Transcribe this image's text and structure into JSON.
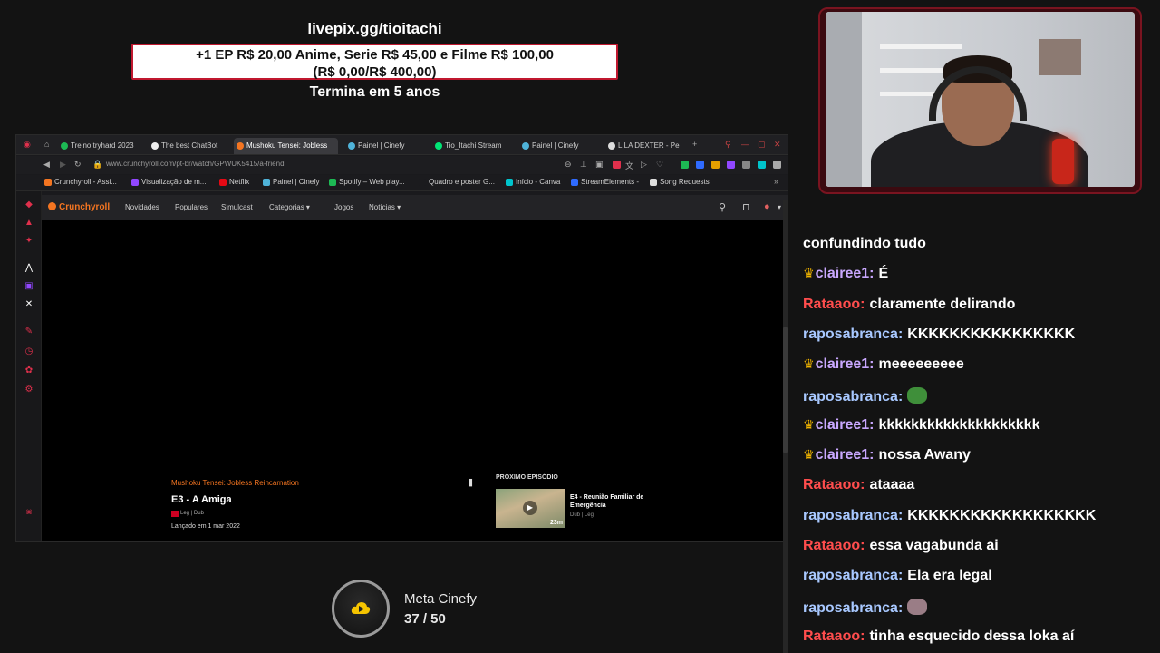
{
  "overlay": {
    "livepix_url": "livepix.gg/tioitachi",
    "goal_line1": "+1 EP R$ 20,00 Anime, Serie R$ 45,00 e Filme R$ 100,00",
    "goal_line2": "(R$ 0,00/R$ 400,00)",
    "termina": "Termina em 5 anos",
    "meta_title": "Meta Cinefy",
    "meta_count": "37 / 50",
    "accent": "#c0182f"
  },
  "browser": {
    "tabs": [
      {
        "label": "Treino tryhard 2023",
        "color": "#1db954",
        "active": false
      },
      {
        "label": "The best ChatBot",
        "color": "#eeeeee",
        "active": false
      },
      {
        "label": "Mushoku Tensei: Jobless",
        "color": "#f47521",
        "active": true
      },
      {
        "label": "Painel | Cinefy",
        "color": "#4fb3d9",
        "active": false
      },
      {
        "label": "Tio_Itachi Stream",
        "color": "#00e676",
        "active": false
      },
      {
        "label": "Painel | Cinefy",
        "color": "#4fb3d9",
        "active": false
      },
      {
        "label": "LILA DEXTER - Pe",
        "color": "#dddddd",
        "active": false
      }
    ],
    "url": "www.crunchyroll.com/pt-br/watch/GPWUK5415/a-friend",
    "bookmarks": [
      {
        "label": "Crunchyroll - Assi...",
        "color": "#f47521"
      },
      {
        "label": "Visualização de m...",
        "color": "#9147ff"
      },
      {
        "label": "Netflix",
        "color": "#e50914"
      },
      {
        "label": "Painel | Cinefy",
        "color": "#4fb3d9"
      },
      {
        "label": "Spotify – Web play...",
        "color": "#1db954"
      },
      {
        "label": "Quadro e poster G...",
        "color": "#1b1b1e"
      },
      {
        "label": "Início - Canva",
        "color": "#00c4cc"
      },
      {
        "label": "StreamElements -",
        "color": "#2f6bff"
      },
      {
        "label": "Song Requests",
        "color": "#dddddd"
      }
    ],
    "crunchyroll": {
      "logo": "Crunchyroll",
      "nav": [
        "Novidades",
        "Populares",
        "Simulcast",
        "Categorias",
        "Jogos",
        "Notícias"
      ],
      "series": "Mushoku Tensei: Jobless Reincarnation",
      "episode_title": "E3 - A Amiga",
      "tags": "Leg | Dub",
      "release": "Lançado em 1 mar 2022",
      "next_label": "PRÓXIMO EPISÓDIO",
      "next_title": "E4 - Reunião Familiar de Emergência",
      "next_tags": "Dub | Leg",
      "next_duration": "23m"
    }
  },
  "chat": [
    {
      "user": "",
      "text": "confundindo tudo",
      "color": "#ffffff",
      "crown": false
    },
    {
      "user": "clairee1:",
      "text": "É",
      "color": "#c9a8ff",
      "crown": true
    },
    {
      "user": "Rataaoo:",
      "text": "claramente delirando",
      "color": "#ff4d4d",
      "crown": false
    },
    {
      "user": "raposabranca:",
      "text": "KKKKKKKKKKKKKKKK",
      "color": "#a8c8ff",
      "crown": false
    },
    {
      "user": "clairee1:",
      "text": "meeeeeeeee",
      "color": "#c9a8ff",
      "crown": true
    },
    {
      "user": "raposabranca:",
      "text": "",
      "color": "#a8c8ff",
      "crown": false,
      "emote": "pepe-emote"
    },
    {
      "user": "clairee1:",
      "text": "kkkkkkkkkkkkkkkkkkkk",
      "color": "#c9a8ff",
      "crown": true
    },
    {
      "user": "clairee1:",
      "text": "nossa Awany",
      "color": "#c9a8ff",
      "crown": true
    },
    {
      "user": "Rataaoo:",
      "text": "ataaaa",
      "color": "#ff4d4d",
      "crown": false
    },
    {
      "user": "raposabranca:",
      "text": "KKKKKKKKKKKKKKKKKK",
      "color": "#a8c8ff",
      "crown": false
    },
    {
      "user": "Rataaoo:",
      "text": "essa vagabunda ai",
      "color": "#ff4d4d",
      "crown": false
    },
    {
      "user": "raposabranca:",
      "text": "Ela era legal",
      "color": "#a8c8ff",
      "crown": false
    },
    {
      "user": "raposabranca:",
      "text": "",
      "color": "#a8c8ff",
      "crown": false,
      "emote": "cat-emote"
    },
    {
      "user": "Rataaoo:",
      "text": "tinha esquecido dessa loka aí",
      "color": "#ff4d4d",
      "crown": false
    }
  ]
}
